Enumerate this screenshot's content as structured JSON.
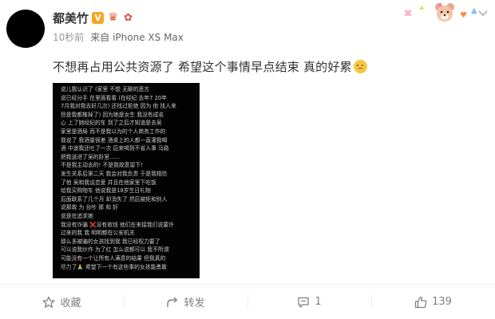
{
  "author": {
    "name": "都美竹",
    "badges": [
      "V",
      "crown",
      "gift"
    ]
  },
  "meta": {
    "time": "10秒前",
    "source": "来自 iPhone XS Max"
  },
  "post": {
    "text": "不想再占用公共资源了 希望这个事情早点结束 真的好累",
    "emoji": "sad-face-emoji"
  },
  "image": {
    "lines": [
      "说儿我认识了 (家里 不想 无聊的恶言",
      "说已经分手 在里面看看 (在经纪 去年7 20年",
      "7月我对我去好几次) 还找过拒绝 因为 他 找人来",
      "但是我都推掉了) 因为她是女生 我没有成名",
      "心 上了她经纪的车 到了之后才知道是去吴",
      "家里是酒局 而不是我以为的个人商务工作的",
      "我说了 我酒量很差 酒桌上的人都一直灌我喝",
      "酒 中途我还吐了一次 后来喝到不省人事 马路",
      "把我送进了吴的卧室......",
      "不是我主动去的! 不是我故意留下!",
      "发生关系后第二天 我会对我负责 于是我相信",
      "了他 吴和我谈恋爱 并且在他家里下吃饭",
      "给我买购物车 他说我是18岁生日礼物",
      "后面联系了几个月 却消失了 然后被拒和别人",
      "说那故 为 台吵 那 和 好",
      "说是在追求她",
      "我没有诈骗 ❌没有收钱 他们在来接我们说要许",
      "过来的我 我 明明都在公安机关",
      "那么多被骗的女孩找到我 我已经权力要了",
      "可以说我炒作 为了红 怎么说都可以 我不所谓",
      "可能没有一个让所有人满意的结果 但我真的",
      "尽力了🙏 希望下一个有这些事的女孩能勇敢"
    ]
  },
  "actions": {
    "collect": {
      "label": "收藏",
      "icon": "collect-icon"
    },
    "repost": {
      "label": "转发",
      "icon": "repost-icon"
    },
    "comment": {
      "label": "1",
      "icon": "comment-icon"
    },
    "like": {
      "label": "139",
      "icon": "like-icon"
    }
  },
  "colors": {
    "accent_orange": "#f6a623",
    "meta_gray": "#999999",
    "action_gray": "#808080",
    "image_bg": "#030303",
    "image_red": "#ff4747"
  }
}
